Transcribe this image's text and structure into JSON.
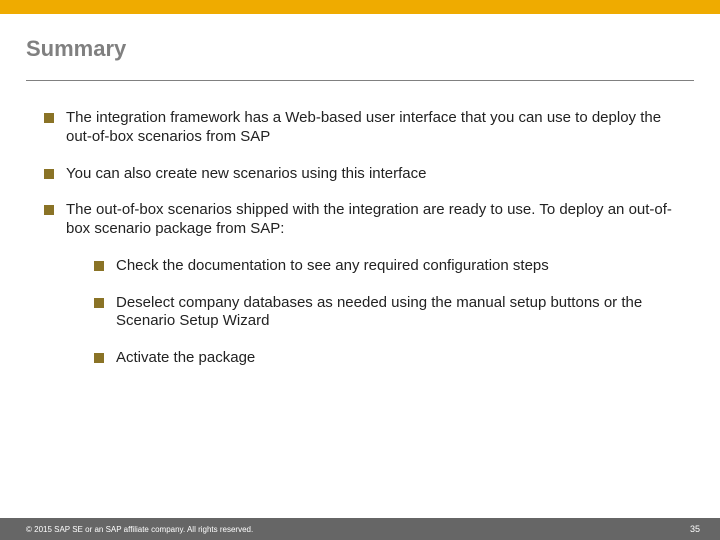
{
  "title": "Summary",
  "bullets": [
    {
      "text": "The integration framework has a Web-based user interface that you can use to deploy the out-of-box scenarios from SAP"
    },
    {
      "text": "You can also create new scenarios using this interface"
    },
    {
      "text": "The out-of-box scenarios shipped with the integration are ready to use. To deploy an out-of-box scenario package from SAP:",
      "sub": [
        {
          "text": "Check the documentation to see any required configuration steps"
        },
        {
          "text": "Deselect company databases as needed using the manual setup buttons or the Scenario Setup Wizard"
        },
        {
          "text": "Activate the package"
        }
      ]
    }
  ],
  "footer": {
    "copyright": "© 2015 SAP SE or an SAP affiliate company. All rights reserved.",
    "page": "35"
  }
}
